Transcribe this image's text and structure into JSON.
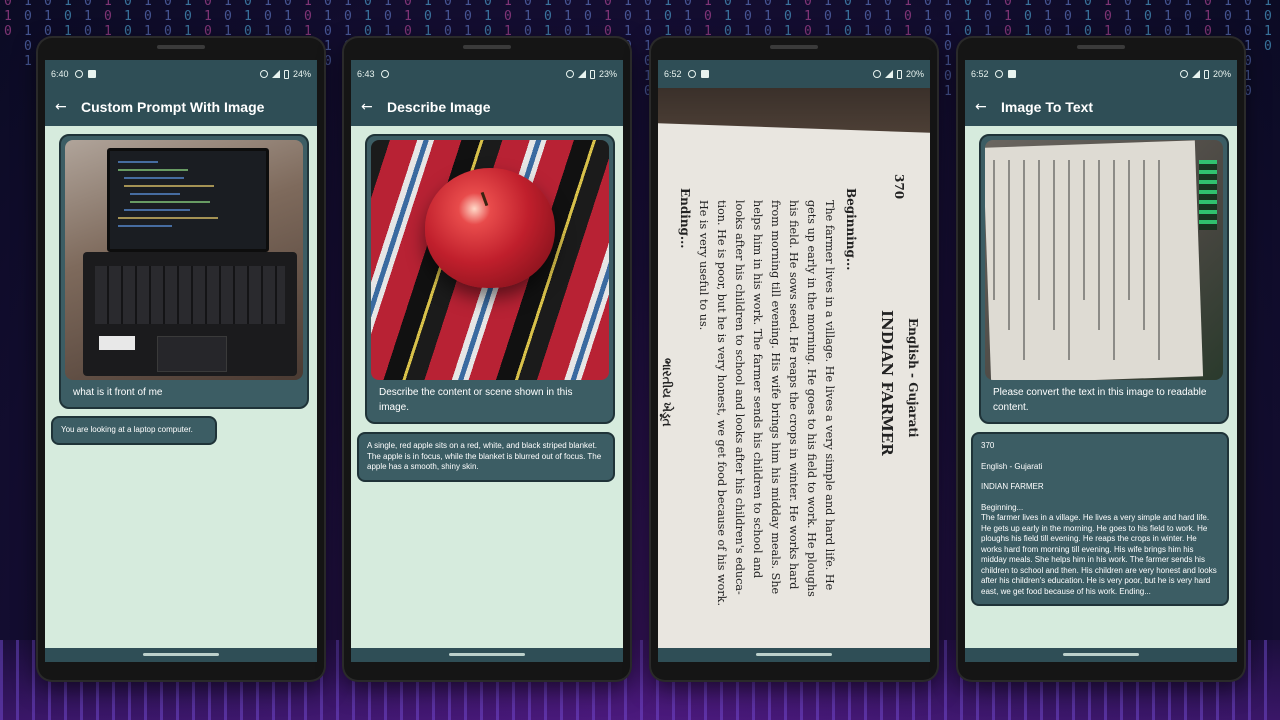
{
  "phones": [
    {
      "status": {
        "time": "6:40",
        "battery": "24%"
      },
      "appbar": {
        "back_icon": "arrow-left-icon",
        "title": "Custom Prompt With Image"
      },
      "user_message": {
        "image": "laptop-photo",
        "text": "what is it front of me"
      },
      "bot_message": {
        "text": "You are looking at a laptop computer."
      }
    },
    {
      "status": {
        "time": "6:43",
        "battery": "23%"
      },
      "appbar": {
        "back_icon": "arrow-left-icon",
        "title": "Describe Image"
      },
      "user_message": {
        "image": "apple-photo",
        "text": "Describe the content or scene shown in this image."
      },
      "bot_message": {
        "text": "A single, red apple sits on a red, white, and black striped blanket. The apple is in focus, while the blanket is blurred out of focus. The apple has a smooth, shiny skin."
      }
    },
    {
      "status": {
        "time": "6:52",
        "battery": "20%"
      },
      "camera": {
        "header": "English - Gujarati",
        "title": "INDIAN FARMER",
        "page_number": "370",
        "beginning": "Beginning...",
        "lines": [
          "The farmer lives in a village. He lives a very simple and hard life. He",
          "gets up early in the morning. He goes to his field to work. He ploughs",
          "his field. He sows seed. He reaps the crops in winter. He works hard",
          "from morning till evening. His wife brings him his midday meals. She",
          "helps him in his work. The farmer sends his children to school and",
          "looks after his children to school and looks after his children's educa-",
          "tion. He is poor, but he is very honest, we get food because of his work.",
          "He is very useful to us."
        ],
        "ending": "Ending...",
        "gujarati": "ભારતીય ખેડૂત"
      }
    },
    {
      "status": {
        "time": "6:52",
        "battery": "20%"
      },
      "appbar": {
        "back_icon": "arrow-left-icon",
        "title": "Image To Text"
      },
      "user_message": {
        "image": "book-page-photo",
        "text": "Please convert the text in this image to readable content."
      },
      "bot_message": {
        "page_number": "370",
        "header": "English - Gujarati",
        "title": "INDIAN FARMER",
        "body": "Beginning...\nThe farmer lives in a village. He lives a very simple and hard life. He gets up early in the morning. He goes to his field to work. He ploughs his field till evening. He reaps the crops in winter. He works hard from morning till evening. His wife brings him his midday meals. She helps him in his work. The farmer sends his children to school and then. His children are very honest and looks after his children's education. He is very poor, but he is very hard east, we get food because of his work. Ending..."
      }
    }
  ]
}
